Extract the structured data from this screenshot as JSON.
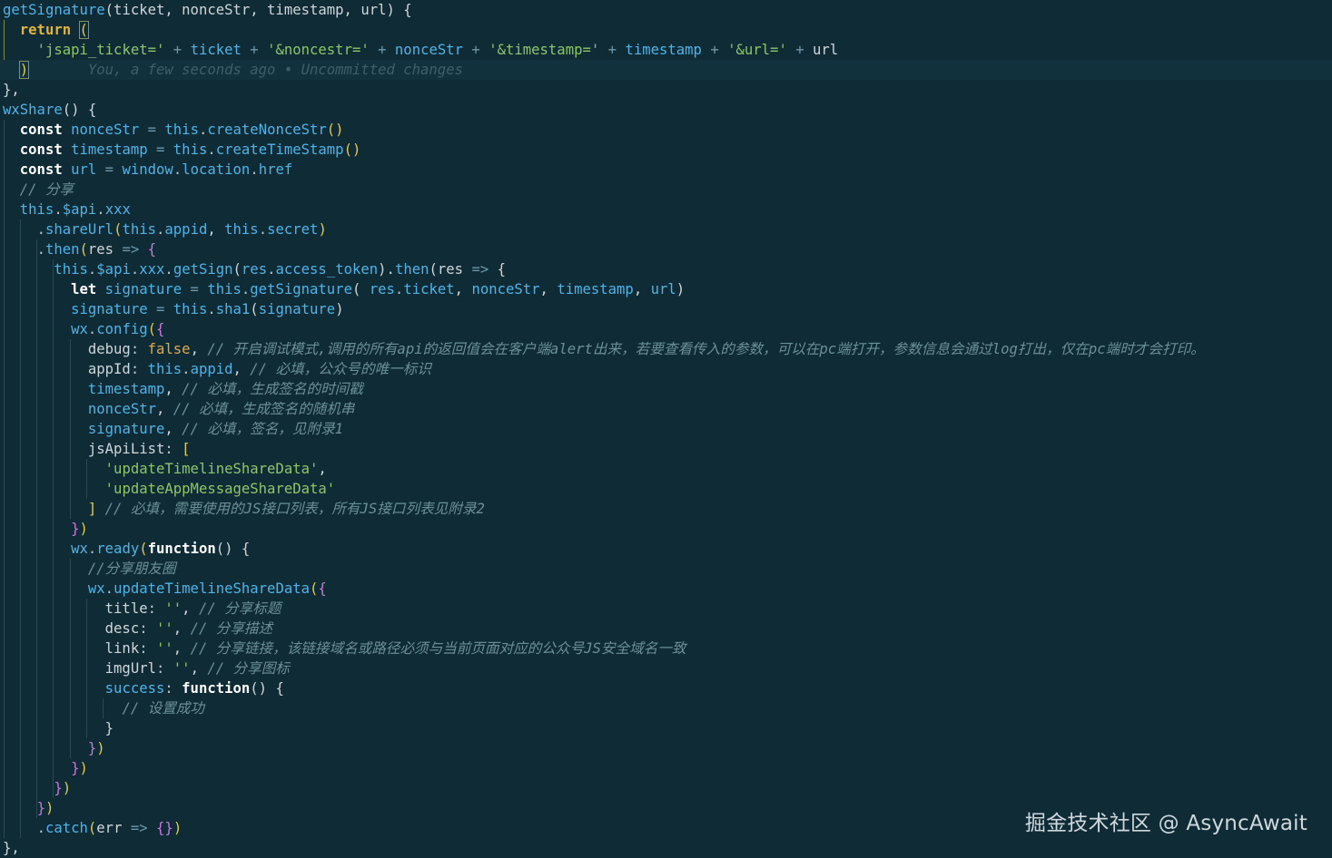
{
  "colors": {
    "background": "#0f2c36",
    "current_line_background": "#11323d",
    "plain": "#d0d5d8",
    "keyword": "#ffffff",
    "variable": "#4fb3e8",
    "method": "#4fb3e8",
    "punctuation": "#b9c4c8",
    "operator": "#6c98ac",
    "string": "#8ec46b",
    "boolean": "#e0a84a",
    "comment": "#6b8f96",
    "return_keyword": "#dfb53e",
    "paren": "#e3c94f",
    "brace": "#c678dd",
    "blame": "#3f5f68"
  },
  "editor": {
    "lines": [
      [
        [
          "method",
          "getSignature"
        ],
        [
          "plain",
          "(ticket, nonceStr, timestamp, url) {"
        ]
      ],
      [
        [
          "plain",
          "  "
        ],
        [
          "return_keyword",
          "return "
        ],
        [
          "paren",
          "("
        ]
      ],
      [
        [
          "plain",
          "    "
        ],
        [
          "string",
          "'jsapi_ticket='"
        ],
        [
          "operator",
          " + "
        ],
        [
          "variable",
          "ticket"
        ],
        [
          "operator",
          " + "
        ],
        [
          "string",
          "'&noncestr='"
        ],
        [
          "operator",
          " + "
        ],
        [
          "variable",
          "nonceStr"
        ],
        [
          "operator",
          " + "
        ],
        [
          "string",
          "'&timestamp='"
        ],
        [
          "operator",
          " + "
        ],
        [
          "variable",
          "timestamp"
        ],
        [
          "operator",
          " + "
        ],
        [
          "string",
          "'&url='"
        ],
        [
          "operator",
          " + "
        ],
        [
          "plain",
          "url"
        ]
      ],
      [
        [
          "plain",
          "  "
        ],
        [
          "paren",
          ")"
        ],
        [
          "blame",
          "       You, a few seconds ago • Uncommitted changes"
        ]
      ],
      [
        [
          "plain",
          "},"
        ]
      ],
      [
        [
          "method",
          "wxShare"
        ],
        [
          "plain",
          "() {"
        ]
      ],
      [
        [
          "plain",
          "  "
        ],
        [
          "keyword",
          "const "
        ],
        [
          "variable",
          "nonceStr"
        ],
        [
          "operator",
          " = "
        ],
        [
          "variable",
          "this"
        ],
        [
          "punctuation",
          "."
        ],
        [
          "method",
          "createNonceStr"
        ],
        [
          "paren",
          "()"
        ]
      ],
      [
        [
          "plain",
          "  "
        ],
        [
          "keyword",
          "const "
        ],
        [
          "variable",
          "timestamp"
        ],
        [
          "operator",
          " = "
        ],
        [
          "variable",
          "this"
        ],
        [
          "punctuation",
          "."
        ],
        [
          "method",
          "createTimeStamp"
        ],
        [
          "paren",
          "()"
        ]
      ],
      [
        [
          "plain",
          "  "
        ],
        [
          "keyword",
          "const "
        ],
        [
          "variable",
          "url"
        ],
        [
          "operator",
          " = "
        ],
        [
          "variable",
          "window"
        ],
        [
          "punctuation",
          "."
        ],
        [
          "variable",
          "location"
        ],
        [
          "punctuation",
          "."
        ],
        [
          "variable",
          "href"
        ]
      ],
      [
        [
          "plain",
          "  "
        ],
        [
          "comment",
          "// 分享"
        ]
      ],
      [
        [
          "plain",
          "  "
        ],
        [
          "variable",
          "this"
        ],
        [
          "punctuation",
          "."
        ],
        [
          "variable",
          "$api"
        ],
        [
          "punctuation",
          "."
        ],
        [
          "variable",
          "xxx"
        ]
      ],
      [
        [
          "plain",
          "    "
        ],
        [
          "punctuation",
          "."
        ],
        [
          "method",
          "shareUrl"
        ],
        [
          "paren",
          "("
        ],
        [
          "variable",
          "this"
        ],
        [
          "punctuation",
          "."
        ],
        [
          "variable",
          "appid"
        ],
        [
          "plain",
          ", "
        ],
        [
          "variable",
          "this"
        ],
        [
          "punctuation",
          "."
        ],
        [
          "variable",
          "secret"
        ],
        [
          "paren",
          ")"
        ]
      ],
      [
        [
          "plain",
          "    "
        ],
        [
          "punctuation",
          "."
        ],
        [
          "method",
          "then"
        ],
        [
          "paren",
          "("
        ],
        [
          "plain",
          "res "
        ],
        [
          "operator",
          "=>"
        ],
        [
          "plain",
          " "
        ],
        [
          "brace",
          "{"
        ]
      ],
      [
        [
          "plain",
          "      "
        ],
        [
          "variable",
          "this"
        ],
        [
          "punctuation",
          "."
        ],
        [
          "variable",
          "$api"
        ],
        [
          "punctuation",
          "."
        ],
        [
          "variable",
          "xxx"
        ],
        [
          "punctuation",
          "."
        ],
        [
          "method",
          "getSign"
        ],
        [
          "plain",
          "("
        ],
        [
          "variable",
          "res"
        ],
        [
          "punctuation",
          "."
        ],
        [
          "variable",
          "access_token"
        ],
        [
          "plain",
          ")."
        ],
        [
          "method",
          "then"
        ],
        [
          "plain",
          "(res "
        ],
        [
          "operator",
          "=>"
        ],
        [
          "plain",
          " {"
        ]
      ],
      [
        [
          "plain",
          "        "
        ],
        [
          "keyword",
          "let "
        ],
        [
          "variable",
          "signature"
        ],
        [
          "operator",
          " = "
        ],
        [
          "variable",
          "this"
        ],
        [
          "punctuation",
          "."
        ],
        [
          "method",
          "getSignature"
        ],
        [
          "plain",
          "( "
        ],
        [
          "variable",
          "res"
        ],
        [
          "punctuation",
          "."
        ],
        [
          "variable",
          "ticket"
        ],
        [
          "plain",
          ", "
        ],
        [
          "variable",
          "nonceStr"
        ],
        [
          "plain",
          ", "
        ],
        [
          "variable",
          "timestamp"
        ],
        [
          "plain",
          ", "
        ],
        [
          "variable",
          "url"
        ],
        [
          "plain",
          ")"
        ]
      ],
      [
        [
          "plain",
          "        "
        ],
        [
          "variable",
          "signature"
        ],
        [
          "operator",
          " = "
        ],
        [
          "variable",
          "this"
        ],
        [
          "punctuation",
          "."
        ],
        [
          "method",
          "sha1"
        ],
        [
          "plain",
          "("
        ],
        [
          "variable",
          "signature"
        ],
        [
          "plain",
          ")"
        ]
      ],
      [
        [
          "plain",
          "        "
        ],
        [
          "variable",
          "wx"
        ],
        [
          "punctuation",
          "."
        ],
        [
          "method",
          "config"
        ],
        [
          "paren",
          "("
        ],
        [
          "brace",
          "{"
        ]
      ],
      [
        [
          "plain",
          "          debug"
        ],
        [
          "punctuation",
          ": "
        ],
        [
          "boolean",
          "false"
        ],
        [
          "plain",
          ", "
        ],
        [
          "comment",
          "// 开启调试模式,调用的所有api的返回值会在客户端alert出来，若要查看传入的参数，可以在pc端打开，参数信息会通过log打出，仅在pc端时才会打印。"
        ]
      ],
      [
        [
          "plain",
          "          appId"
        ],
        [
          "punctuation",
          ": "
        ],
        [
          "variable",
          "this"
        ],
        [
          "punctuation",
          "."
        ],
        [
          "variable",
          "appid"
        ],
        [
          "plain",
          ", "
        ],
        [
          "comment",
          "// 必填，公众号的唯一标识"
        ]
      ],
      [
        [
          "plain",
          "          "
        ],
        [
          "variable",
          "timestamp"
        ],
        [
          "plain",
          ", "
        ],
        [
          "comment",
          "// 必填，生成签名的时间戳"
        ]
      ],
      [
        [
          "plain",
          "          "
        ],
        [
          "variable",
          "nonceStr"
        ],
        [
          "plain",
          ", "
        ],
        [
          "comment",
          "// 必填，生成签名的随机串"
        ]
      ],
      [
        [
          "plain",
          "          "
        ],
        [
          "variable",
          "signature"
        ],
        [
          "plain",
          ", "
        ],
        [
          "comment",
          "// 必填，签名，见附录1"
        ]
      ],
      [
        [
          "plain",
          "          jsApiList"
        ],
        [
          "punctuation",
          ": "
        ],
        [
          "paren",
          "["
        ]
      ],
      [
        [
          "plain",
          "            "
        ],
        [
          "string",
          "'updateTimelineShareData'"
        ],
        [
          "plain",
          ","
        ]
      ],
      [
        [
          "plain",
          "            "
        ],
        [
          "string",
          "'updateAppMessageShareData'"
        ]
      ],
      [
        [
          "plain",
          "          "
        ],
        [
          "paren",
          "]"
        ],
        [
          "plain",
          " "
        ],
        [
          "comment",
          "// 必填，需要使用的JS接口列表，所有JS接口列表见附录2"
        ]
      ],
      [
        [
          "plain",
          "        "
        ],
        [
          "brace",
          "}"
        ],
        [
          "paren",
          ")"
        ]
      ],
      [
        [
          "plain",
          "        "
        ],
        [
          "variable",
          "wx"
        ],
        [
          "punctuation",
          "."
        ],
        [
          "method",
          "ready"
        ],
        [
          "paren",
          "("
        ],
        [
          "keyword",
          "function"
        ],
        [
          "plain",
          "() {"
        ]
      ],
      [
        [
          "plain",
          "          "
        ],
        [
          "comment",
          "//分享朋友圈"
        ]
      ],
      [
        [
          "plain",
          "          "
        ],
        [
          "variable",
          "wx"
        ],
        [
          "punctuation",
          "."
        ],
        [
          "method",
          "updateTimelineShareData"
        ],
        [
          "paren",
          "("
        ],
        [
          "brace",
          "{"
        ]
      ],
      [
        [
          "plain",
          "            title"
        ],
        [
          "punctuation",
          ": "
        ],
        [
          "string",
          "''"
        ],
        [
          "plain",
          ", "
        ],
        [
          "comment",
          "// 分享标题"
        ]
      ],
      [
        [
          "plain",
          "            desc"
        ],
        [
          "punctuation",
          ": "
        ],
        [
          "string",
          "''"
        ],
        [
          "plain",
          ", "
        ],
        [
          "comment",
          "// 分享描述"
        ]
      ],
      [
        [
          "plain",
          "            link"
        ],
        [
          "punctuation",
          ": "
        ],
        [
          "string",
          "''"
        ],
        [
          "plain",
          ", "
        ],
        [
          "comment",
          "// 分享链接，该链接域名或路径必须与当前页面对应的公众号JS安全域名一致"
        ]
      ],
      [
        [
          "plain",
          "            imgUrl"
        ],
        [
          "punctuation",
          ": "
        ],
        [
          "string",
          "''"
        ],
        [
          "plain",
          ", "
        ],
        [
          "comment",
          "// 分享图标"
        ]
      ],
      [
        [
          "plain",
          "            "
        ],
        [
          "method",
          "success"
        ],
        [
          "punctuation",
          ": "
        ],
        [
          "keyword",
          "function"
        ],
        [
          "plain",
          "() {"
        ]
      ],
      [
        [
          "plain",
          "              "
        ],
        [
          "comment",
          "// 设置成功"
        ]
      ],
      [
        [
          "plain",
          "            }"
        ]
      ],
      [
        [
          "plain",
          "          "
        ],
        [
          "brace",
          "}"
        ],
        [
          "paren",
          ")"
        ]
      ],
      [
        [
          "plain",
          "        "
        ],
        [
          "brace",
          "}"
        ],
        [
          "paren",
          ")"
        ]
      ],
      [
        [
          "plain",
          "      "
        ],
        [
          "brace",
          "}"
        ],
        [
          "paren",
          ")"
        ]
      ],
      [
        [
          "plain",
          "    "
        ],
        [
          "brace",
          "}"
        ],
        [
          "paren",
          ")"
        ]
      ],
      [
        [
          "plain",
          "    "
        ],
        [
          "punctuation",
          "."
        ],
        [
          "method",
          "catch"
        ],
        [
          "paren",
          "("
        ],
        [
          "plain",
          "err "
        ],
        [
          "operator",
          "=>"
        ],
        [
          "plain",
          " "
        ],
        [
          "brace",
          "{}"
        ],
        [
          "paren",
          ")"
        ]
      ],
      [
        [
          "plain",
          "},"
        ]
      ]
    ],
    "current_line": 3,
    "bracket_highlight_lines": [
      1,
      3
    ]
  },
  "watermark": "掘金技术社区 @ AsyncAwait"
}
